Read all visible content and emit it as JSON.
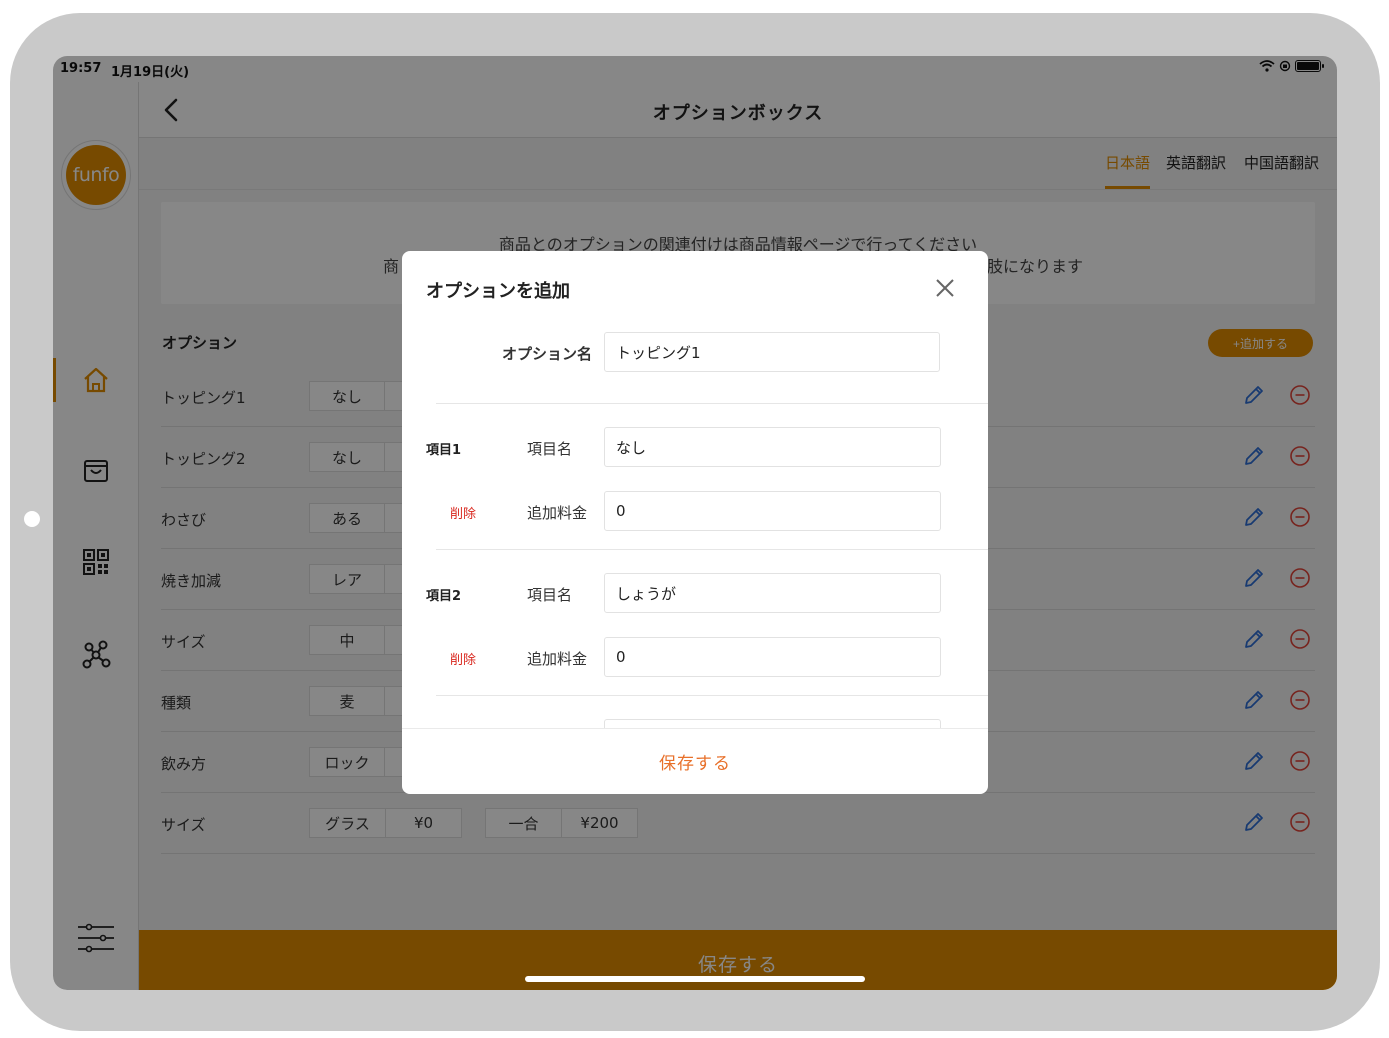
{
  "status_bar": {
    "time": "19:57",
    "date": "1月19日(火)"
  },
  "logo": {
    "text": "funfo"
  },
  "header": {
    "title": "オプションボックス"
  },
  "tabs": [
    {
      "label": "日本語",
      "active": true
    },
    {
      "label": "英語翻訳",
      "active": false
    },
    {
      "label": "中国語翻訳",
      "active": false
    }
  ],
  "notice": {
    "line1": "商品とのオプションの関連付けは商品情報ページで行ってください",
    "line2_prefix": "商",
    "line2_suffix": "肢になります"
  },
  "options_section": {
    "label": "オプション",
    "add_button": "+追加する"
  },
  "options": [
    {
      "name": "トッピング1",
      "chip": "なし"
    },
    {
      "name": "トッピング2",
      "chip": "なし"
    },
    {
      "name": "わさび",
      "chip": "ある"
    },
    {
      "name": "焼き加減",
      "chip": "レア"
    },
    {
      "name": "サイズ",
      "chip": "中"
    },
    {
      "name": "種類",
      "chip": "麦"
    },
    {
      "name": "飲み方",
      "chip": "ロック"
    },
    {
      "name": "サイズ",
      "chip": "グラス",
      "price": "¥0",
      "chip2": "一合",
      "price2": "¥200"
    }
  ],
  "bottom_bar": {
    "save_label": "保存する"
  },
  "modal": {
    "title": "オプションを追加",
    "option_name_label": "オプション名",
    "option_name_value": "トッピング1",
    "items": [
      {
        "label": "項目1",
        "delete": "削除",
        "name_label": "項目名",
        "name_value": "なし",
        "price_label": "追加料金",
        "price_value": "0"
      },
      {
        "label": "項目2",
        "delete": "削除",
        "name_label": "項目名",
        "name_value": "しょうが",
        "price_label": "追加料金",
        "price_value": "0"
      }
    ],
    "save_label": "保存する"
  },
  "colors": {
    "accent": "#e08c00",
    "delete": "#d9281f",
    "edit": "#2f6fd6",
    "remove": "#e0453a",
    "modal_save": "#e8702a"
  },
  "icons": [
    "back-icon",
    "home-icon",
    "bag-icon",
    "qr-code-icon",
    "network-icon",
    "settings-sliders-icon",
    "pencil-icon",
    "minus-circle-icon",
    "close-icon",
    "wifi-icon",
    "battery-icon"
  ]
}
